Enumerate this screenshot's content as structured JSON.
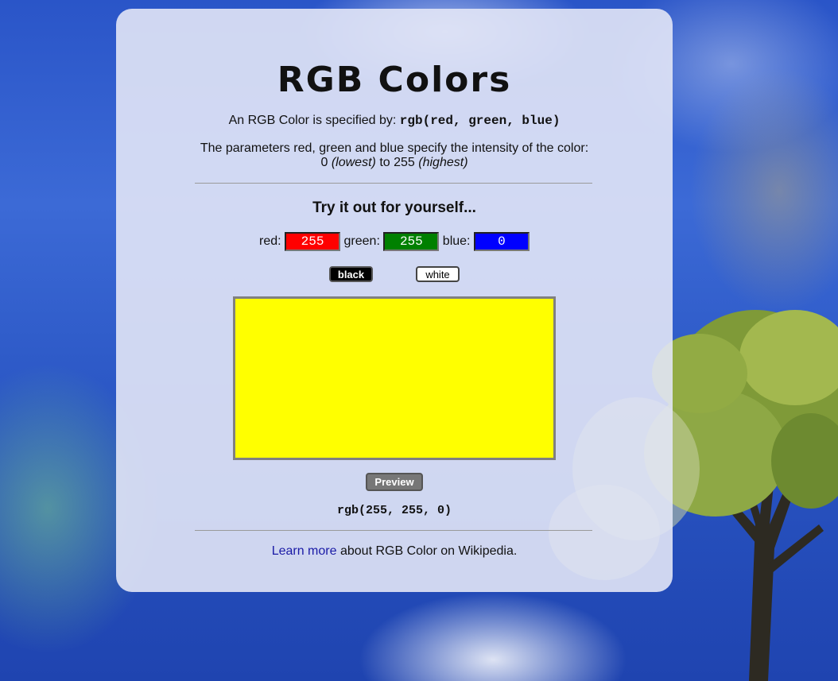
{
  "page": {
    "title": "RGB Colors",
    "intro_text": "An RGB Color is specified by:",
    "intro_code": "rgb(red, green, blue)",
    "params_line1": "The parameters red, green and blue specify the intensity of the color:",
    "params_low_value": "0",
    "params_low_label": "(lowest)",
    "params_to": "to",
    "params_high_value": "255",
    "params_high_label": "(highest)"
  },
  "tryit": {
    "heading": "Try it out for yourself...",
    "red_label": "red:",
    "red_value": "255",
    "red_color": "#ff0000",
    "green_label": "green:",
    "green_value": "255",
    "green_color": "#008000",
    "blue_label": "blue:",
    "blue_value": "0",
    "blue_color": "#0000ff",
    "black_button": "black",
    "white_button": "white",
    "preview_color": "#ffff00",
    "preview_button": "Preview",
    "result": "rgb(255, 255, 0)"
  },
  "footer": {
    "link_text": "Learn more",
    "rest_text": "about RGB Color on Wikipedia."
  }
}
